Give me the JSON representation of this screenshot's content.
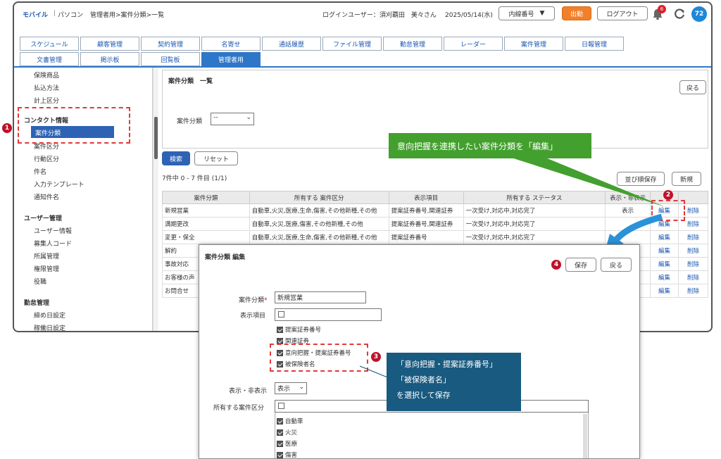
{
  "header": {
    "mobile_link": "モバイル",
    "separator": "|",
    "pc_link": "パソコン",
    "breadcrumb": "管理者用>案件分類>一覧",
    "login_user": "ログインユーザー：須刈覇田　美々さん",
    "date": "2025/05/14(水)",
    "extension_select": "内線番号",
    "clock_in_button": "出勤",
    "logout_button": "ログアウト",
    "notification_count": "6",
    "user_badge": "72"
  },
  "tabs_row1": [
    "スケジュール",
    "顧客管理",
    "契約管理",
    "名寄せ",
    "通話履歴",
    "ファイル管理",
    "勤怠管理",
    "レーダー",
    "案件管理",
    "日報管理"
  ],
  "tabs_row2": [
    "文書管理",
    "掲示板",
    "回覧板",
    "管理者用"
  ],
  "sidebar": {
    "items_top": [
      "保険商品",
      "払込方法",
      "計上区分"
    ],
    "contact_head": "コンタクト情報",
    "contact_selected": "案件分類",
    "contact_items": [
      "案件区分",
      "行動区分",
      "件名",
      "入力テンプレート",
      "通知件名"
    ],
    "user_head": "ユーザー管理",
    "user_items": [
      "ユーザー情報",
      "募集人コード",
      "所属管理",
      "権限管理",
      "役職"
    ],
    "attendance_head": "勤怠管理",
    "attendance_items": [
      "締め日設定",
      "稼働日設定"
    ]
  },
  "main": {
    "title": "案件分類　一覧",
    "back_button": "戻る",
    "filter_label": "案件分類",
    "filter_value": "--",
    "search_button": "検索",
    "reset_button": "リセット",
    "count_text": "7件中 0 - 7 件目 (1/1)",
    "sort_save_button": "並び順保存",
    "new_button": "新規"
  },
  "table": {
    "headers": [
      "案件分類",
      "所有する 案件区分",
      "表示項目",
      "所有する ステータス",
      "表示・非表示",
      "",
      ""
    ],
    "rows": [
      {
        "name": "新規営業",
        "kubun": "自動車,火災,医療,生命,傷害,その他新種,その他",
        "items": "提案証券番号,関連証券",
        "status": "一次受け,対応中,対応完了",
        "visible": "表示",
        "edit": "編集",
        "delete": "削除"
      },
      {
        "name": "満期更改",
        "kubun": "自動車,火災,医療,傷害,その他新種,その他",
        "items": "提案証券番号,関連証券",
        "status": "一次受け,対応中,対応完了",
        "visible": "",
        "edit": "編集",
        "delete": "削除"
      },
      {
        "name": "変更・保全",
        "kubun": "自動車,火災,医療,生命,傷害,その他新種,その他",
        "items": "提案証券番号",
        "status": "一次受け,対応中,対応完了",
        "visible": "",
        "edit": "編集",
        "delete": "削除"
      },
      {
        "name": "解約",
        "kubun": "",
        "items": "",
        "status": "",
        "visible": "",
        "edit": "編集",
        "delete": "削除"
      },
      {
        "name": "事故対応",
        "kubun": "",
        "items": "",
        "status": "",
        "visible": "",
        "edit": "編集",
        "delete": "削除"
      },
      {
        "name": "お客様の声",
        "kubun": "",
        "items": "",
        "status": "",
        "visible": "",
        "edit": "編集",
        "delete": "削除"
      },
      {
        "name": "お問合せ",
        "kubun": "",
        "items": "",
        "status": "",
        "visible": "",
        "edit": "編集",
        "delete": "削除"
      }
    ]
  },
  "popup": {
    "title": "案件分類  編集",
    "save_button": "保存",
    "back_button": "戻る",
    "name_label": "案件分類",
    "required_mark": "*",
    "name_value": "新規営業",
    "items_label": "表示項目",
    "item_options": [
      "提案証券番号",
      "関連証券",
      "意向把握・提案証券番号",
      "被保険者名"
    ],
    "visible_label": "表示・非表示",
    "visible_value": "表示",
    "kubun_label": "所有する案件区分",
    "kubun_options": [
      "自動車",
      "火災",
      "医療",
      "傷害"
    ]
  },
  "annotations": {
    "n1": "1",
    "n2": "2",
    "n3": "3",
    "n4": "4",
    "green_callout": "意向把握を連携したい案件分類を「編集」",
    "blue_callout_line1": "「意向把握・提案証券番号」",
    "blue_callout_line2": "「被保険者名」",
    "blue_callout_line3": "を選択して保存"
  },
  "colors": {
    "accent_blue": "#2e77c8",
    "annotation_red": "#c0112a",
    "callout_green": "#43a02e",
    "callout_blue": "#185a80",
    "clock_in_orange": "#f0802a"
  }
}
